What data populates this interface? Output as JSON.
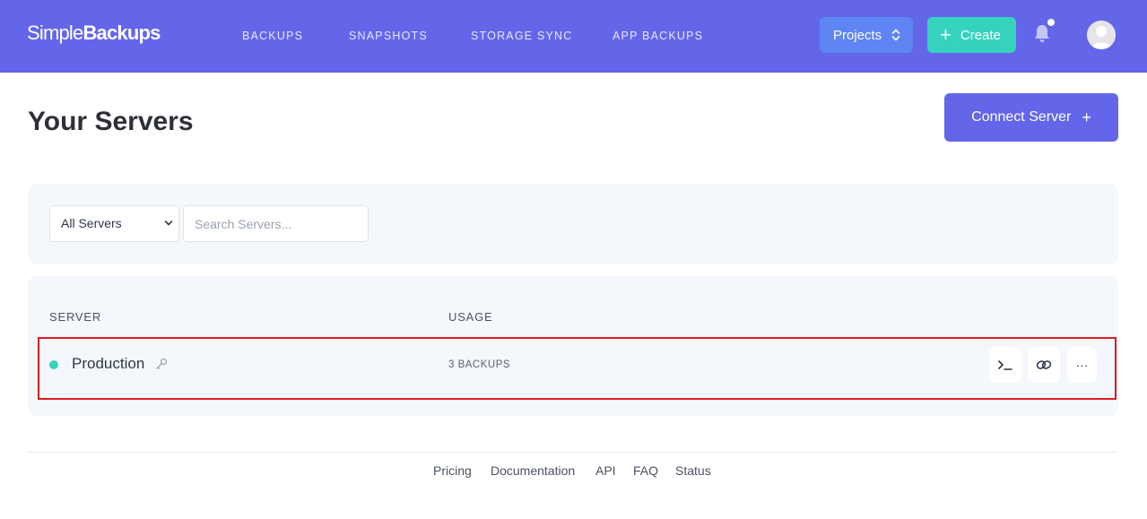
{
  "brand": {
    "part1": "Simple",
    "part2": "Backups"
  },
  "nav": [
    "BACKUPS",
    "SNAPSHOTS",
    "STORAGE SYNC",
    "APP BACKUPS"
  ],
  "header": {
    "projects_label": "Projects",
    "create_label": "Create"
  },
  "page": {
    "title": "Your Servers",
    "connect_label": "Connect Server"
  },
  "filters": {
    "select_value": "All Servers",
    "select_options": [
      "All Servers"
    ],
    "search_placeholder": "Search Servers...",
    "search_value": ""
  },
  "table": {
    "columns": [
      "SERVER",
      "USAGE"
    ],
    "rows": [
      {
        "name": "Production",
        "status": "online",
        "usage": "3 BACKUPS"
      }
    ]
  },
  "actions": {
    "more_label": "···"
  },
  "footer": [
    "Pricing",
    "Documentation",
    "API",
    "FAQ",
    "Status"
  ],
  "colors": {
    "brand": "#6466ea",
    "accent": "#35d3bd",
    "projects": "#5e85f3",
    "highlight": "#d81e1e"
  },
  "icons": [
    "chevron-updown-icon",
    "plus-icon",
    "bell-icon",
    "avatar-icon",
    "chevron-down-icon",
    "key-icon",
    "terminal-icon",
    "link-icon",
    "more-icon"
  ]
}
